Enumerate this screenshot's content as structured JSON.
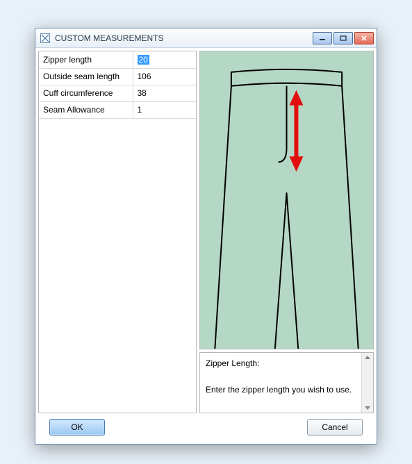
{
  "window": {
    "title": "CUSTOM MEASUREMENTS"
  },
  "measurements": [
    {
      "label": "Zipper length",
      "value": "20",
      "selected": true
    },
    {
      "label": "Outside seam length",
      "value": "106",
      "selected": false
    },
    {
      "label": "Cuff circumference",
      "value": "38",
      "selected": false
    },
    {
      "label": "Seam Allowance",
      "value": "1",
      "selected": false
    }
  ],
  "help": {
    "title": "Zipper Length:",
    "body": "Enter the zipper length you wish to use."
  },
  "buttons": {
    "ok": "OK",
    "cancel": "Cancel"
  }
}
